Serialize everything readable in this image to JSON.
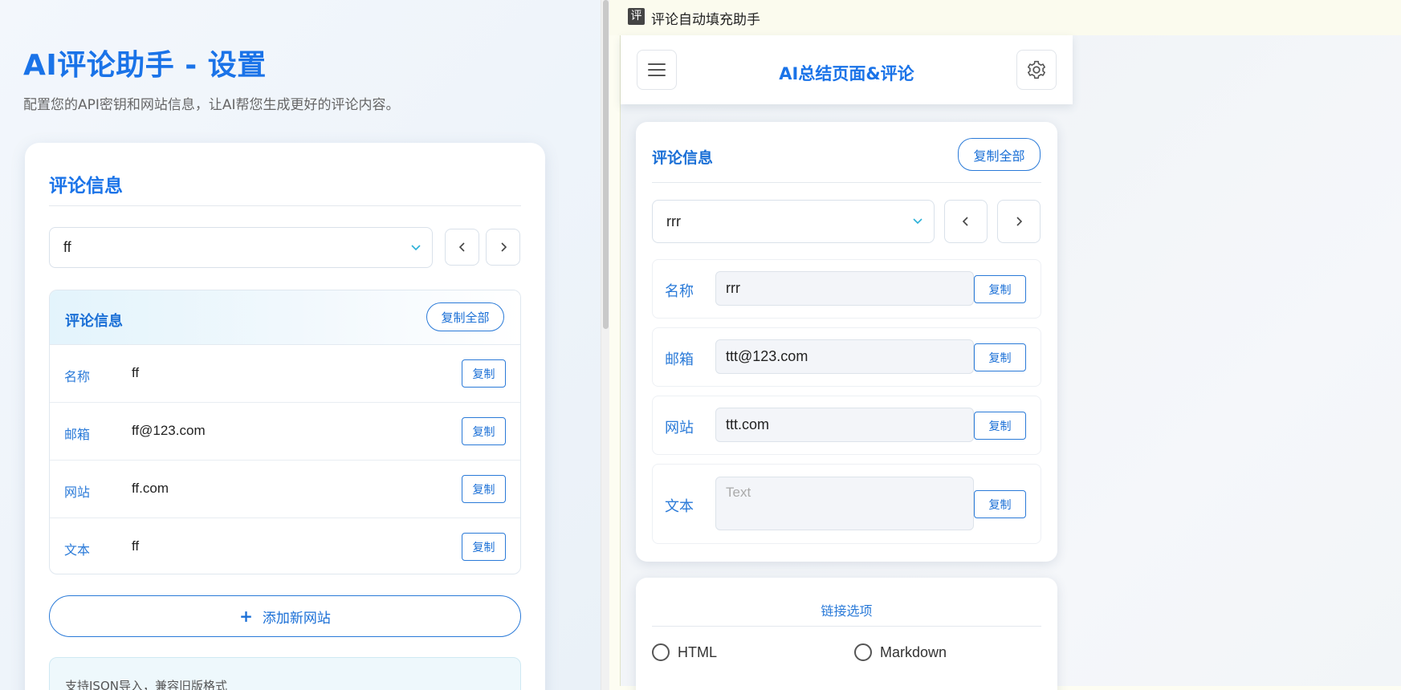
{
  "settings_page": {
    "title": "AI评论助手 - 设置",
    "description": "配置您的API密钥和网站信息，让AI帮您生成更好的评论内容。",
    "card_title": "评论信息",
    "selected_site": "ff",
    "info_box": {
      "title": "评论信息",
      "copy_all_label": "复制全部",
      "rows": [
        {
          "label": "名称",
          "value": "ff",
          "copy_label": "复制"
        },
        {
          "label": "邮箱",
          "value": "ff@123.com",
          "copy_label": "复制"
        },
        {
          "label": "网站",
          "value": "ff.com",
          "copy_label": "复制"
        },
        {
          "label": "文本",
          "value": "ff",
          "copy_label": "复制"
        }
      ]
    },
    "add_site_label": "添加新网站",
    "json_note": "支持JSON导入，兼容旧版格式"
  },
  "side_panel": {
    "app_icon_char": "评",
    "app_title": "评论自动填充助手",
    "header_title": "AI总结页面&评论",
    "comment_card": {
      "title": "评论信息",
      "copy_all_label": "复制全部",
      "selected_site": "rrr",
      "fields": [
        {
          "label": "名称",
          "value": "rrr",
          "copy_label": "复制"
        },
        {
          "label": "邮箱",
          "value": "ttt@123.com",
          "copy_label": "复制"
        },
        {
          "label": "网站",
          "value": "ttt.com",
          "copy_label": "复制"
        },
        {
          "label": "文本",
          "placeholder": "Text",
          "copy_label": "复制"
        }
      ]
    },
    "link_options": {
      "title": "链接选项",
      "options": [
        "HTML",
        "Markdown"
      ]
    }
  },
  "colors": {
    "accent": "#1a73e8",
    "label_blue": "#2a7ad8",
    "chevron": "#2ab0d8"
  },
  "icons": [
    "chevron-down-icon",
    "chevron-left-icon",
    "chevron-right-icon",
    "menu-icon",
    "gear-icon",
    "plus-icon"
  ]
}
